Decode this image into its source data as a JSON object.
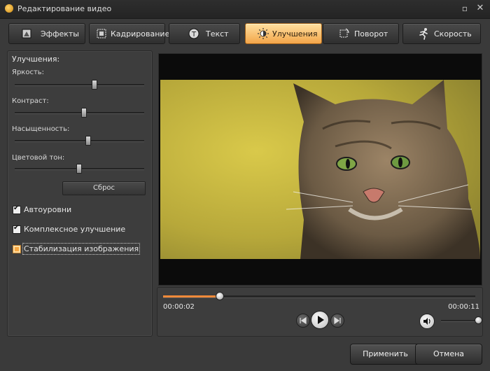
{
  "window": {
    "title": "Редактирование видео",
    "maximize_icon": "▫",
    "close_icon": "✕"
  },
  "tabs": [
    {
      "label": "Эффекты",
      "icon": "effects-icon"
    },
    {
      "label": "Кадрирование",
      "icon": "crop-icon"
    },
    {
      "label": "Текст",
      "icon": "text-icon"
    },
    {
      "label": "Улучшения",
      "icon": "enhance-icon",
      "active": true
    },
    {
      "label": "Поворот",
      "icon": "rotate-icon"
    },
    {
      "label": "Скорость",
      "icon": "speed-icon"
    }
  ],
  "enhancements": {
    "title": "Улучшения:",
    "sliders": [
      {
        "label": "Яркость:",
        "value": 0.61
      },
      {
        "label": "Контраст:",
        "value": 0.53
      },
      {
        "label": "Насыщенность:",
        "value": 0.56
      },
      {
        "label": "Цветовой тон:",
        "value": 0.49
      }
    ],
    "reset_label": "Сброс",
    "options": [
      {
        "label": "Автоуровни",
        "checked": true
      },
      {
        "label": "Комплексное улучшение",
        "checked": true
      },
      {
        "label": "Стабилизация изображения",
        "checked": false
      }
    ]
  },
  "player": {
    "current_time": "00:00:02",
    "total_time": "00:00:11",
    "progress": 0.18,
    "volume": 0.92
  },
  "footer": {
    "apply_label": "Применить",
    "cancel_label": "Отмена"
  },
  "colors": {
    "accent": "#f3a64a",
    "progress": "#f08a3a"
  }
}
